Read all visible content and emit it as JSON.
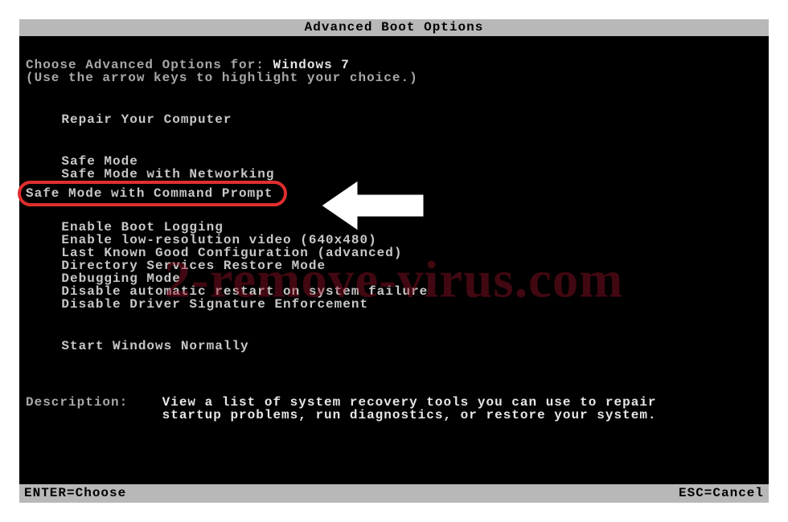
{
  "title": "Advanced Boot Options",
  "prompt_prefix": "Choose Advanced Options for: ",
  "os_name": "Windows 7",
  "prompt_hint": "(Use the arrow keys to highlight your choice.)",
  "menu": {
    "group0": [
      "Repair Your Computer"
    ],
    "group1": [
      "Safe Mode",
      "Safe Mode with Networking"
    ],
    "selected": "Safe Mode with Command Prompt",
    "group2": [
      "Enable Boot Logging",
      "Enable low-resolution video (640x480)",
      "Last Known Good Configuration (advanced)",
      "Directory Services Restore Mode",
      "Debugging Mode",
      "Disable automatic restart on system failure",
      "Disable Driver Signature Enforcement"
    ],
    "group3": [
      "Start Windows Normally"
    ]
  },
  "description": {
    "label": "Description:    ",
    "line1": "View a list of system recovery tools you can use to repair",
    "line2": "startup problems, run diagnostics, or restore your system."
  },
  "footer": {
    "left": "ENTER=Choose",
    "right": "ESC=Cancel"
  },
  "watermark": "2-remove-virus.com"
}
